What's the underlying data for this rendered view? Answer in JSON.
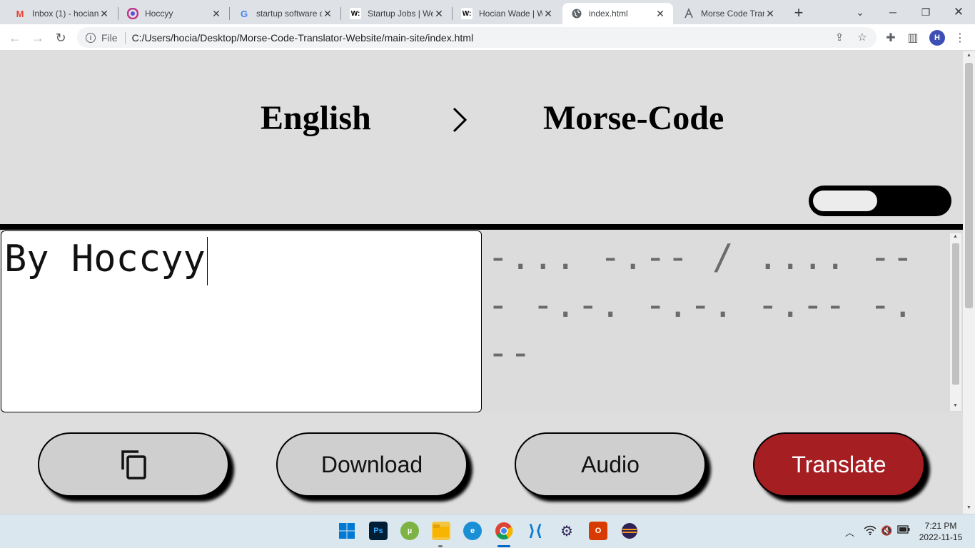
{
  "browser": {
    "tabs": [
      {
        "title": "Inbox (1) - hocian",
        "icon": "gmail-icon"
      },
      {
        "title": "Hoccyy",
        "icon": "hoccyy-icon"
      },
      {
        "title": "startup software d",
        "icon": "google-icon"
      },
      {
        "title": "Startup Jobs | We",
        "icon": "wellfound-icon"
      },
      {
        "title": "Hocian Wade | W",
        "icon": "wellfound-icon"
      },
      {
        "title": "index.html",
        "icon": "globe-icon"
      },
      {
        "title": "Morse Code Tran",
        "icon": "morse-icon"
      }
    ],
    "active_tab": 5,
    "address_prefix": "File",
    "url": "C:/Users/hocia/Desktop/Morse-Code-Translator-Website/main-site/index.html",
    "profile_initial": "H"
  },
  "translator": {
    "source_language": "English",
    "target_language": "Morse-Code",
    "input_text": "By Hoccyy",
    "output_text": "-... -.-- / .... --- -.-. -.-. -.-- -.--",
    "buttons": {
      "copy_icon": "copy-icon",
      "download": "Download",
      "audio": "Audio",
      "translate": "Translate"
    },
    "accent_color": "#a51e22"
  },
  "taskbar": {
    "apps": [
      "start",
      "photoshop",
      "utorrent",
      "file-explorer",
      "edge",
      "chrome",
      "vscode",
      "eclipse",
      "office",
      "eclipse-ide"
    ],
    "time": "7:21 PM",
    "date": "2022-11-15"
  }
}
